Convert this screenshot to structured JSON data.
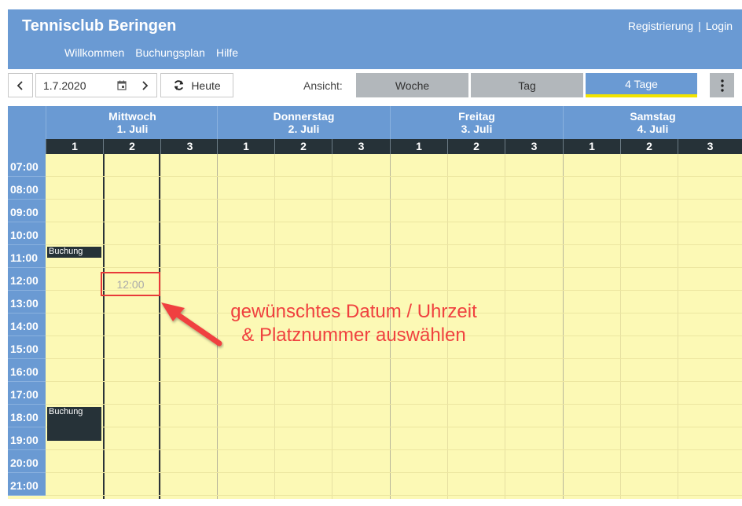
{
  "header": {
    "brand": "Tennisclub Beringen",
    "nav": [
      "Willkommen",
      "Buchungsplan",
      "Hilfe"
    ],
    "registrierung": "Registrierung",
    "separator": "|",
    "login": "Login"
  },
  "toolbar": {
    "date_value": "1.7.2020",
    "today_label": "Heute",
    "view_label": "Ansicht:",
    "views": [
      "Woche",
      "Tag",
      "4 Tage"
    ],
    "active_view": "4 Tage",
    "prev_icon": "chevron-left-icon",
    "next_icon": "chevron-right-icon",
    "calendar_icon": "calendar-icon",
    "refresh_icon": "refresh-icon",
    "menu_icon": "more-vertical-icon"
  },
  "calendar": {
    "days": [
      {
        "name": "Mittwoch",
        "date": "1. Juli"
      },
      {
        "name": "Donnerstag",
        "date": "2. Juli"
      },
      {
        "name": "Freitag",
        "date": "3. Juli"
      },
      {
        "name": "Samstag",
        "date": "4. Juli"
      }
    ],
    "courts": [
      "1",
      "2",
      "3"
    ],
    "times": [
      "07:00",
      "08:00",
      "09:00",
      "10:00",
      "11:00",
      "12:00",
      "13:00",
      "14:00",
      "15:00",
      "16:00",
      "17:00",
      "18:00",
      "19:00",
      "20:00",
      "21:00"
    ],
    "bookings": [
      {
        "label": "Buchung",
        "day": 0,
        "court": 0,
        "start": "11:00"
      },
      {
        "label": "Buchung",
        "day": 0,
        "court": 0,
        "start": "18:00"
      }
    ],
    "selected_slot": {
      "label": "12:00",
      "day": 0,
      "court": 1
    }
  },
  "annotation": {
    "line1": "gewünschtes Datum / Uhrzeit",
    "line2": "& Platznummer auswählen"
  },
  "colors": {
    "header_blue": "#6a9ad3",
    "calendar_bg": "#fcf9b5",
    "dark": "#263238",
    "annotation_red": "#f0413f",
    "active_underline": "#f2e400"
  }
}
